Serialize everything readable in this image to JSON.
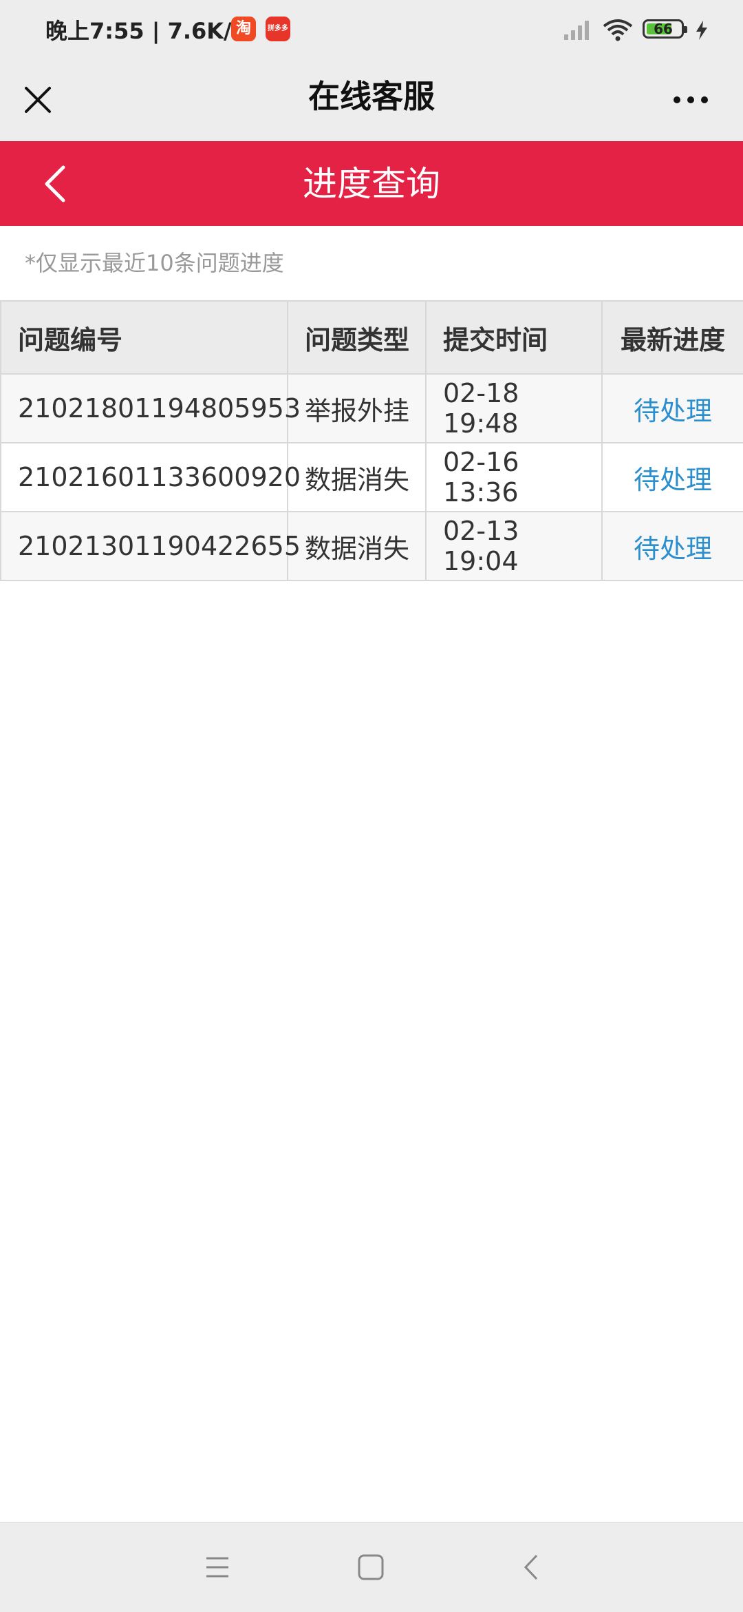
{
  "status_bar": {
    "time_speed": "晚上7:55 | 7.6K/s",
    "app_icon_1": "淘",
    "app_icon_2": "拼多多",
    "battery": "66",
    "icons": [
      "signal-icon",
      "wifi-icon",
      "battery-icon",
      "charging-bolt-icon"
    ]
  },
  "app_bar": {
    "title": "在线客服",
    "close_icon": "close-icon",
    "more_icon": "more-dots-icon"
  },
  "page_header": {
    "title": "进度查询",
    "back_icon": "chevron-left-icon"
  },
  "note": "*仅显示最近10条问题进度",
  "table": {
    "headers": [
      "问题编号",
      "问题类型",
      "提交时间",
      "最新进度"
    ],
    "rows": [
      [
        "21021801194805953",
        "举报外挂",
        "02-18 19:48",
        "待处理"
      ],
      [
        "21021601133600920",
        "数据消失",
        "02-16 13:36",
        "待处理"
      ],
      [
        "21021301190422655",
        "数据消失",
        "02-13 19:04",
        "待处理"
      ]
    ]
  },
  "colors": {
    "accent_red": "#e32245",
    "link_blue": "#2a8fcc",
    "header_gray": "#ebebeb"
  },
  "nav": {
    "icons": [
      "menu-icon",
      "home-square-icon",
      "back-chevron-icon"
    ]
  }
}
